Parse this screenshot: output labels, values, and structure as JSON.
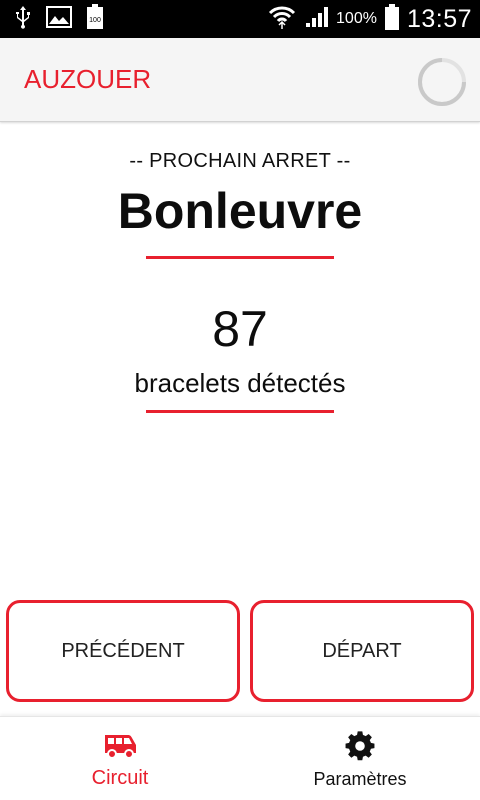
{
  "status_bar": {
    "battery_percent": "100%",
    "battery_small": "100",
    "time": "13:57",
    "icons": [
      "usb-icon",
      "image-icon",
      "battery-small-icon",
      "wifi-icon",
      "signal-icon",
      "battery-icon"
    ]
  },
  "app_bar": {
    "title": "AUZOUER",
    "spinner_icon": "loading-spinner-icon"
  },
  "main": {
    "next_stop_label": "-- PROCHAIN ARRET --",
    "stop_name": "Bonleuvre",
    "count": "87",
    "count_label": "bracelets détectés"
  },
  "actions": {
    "previous_label": "PRÉCÉDENT",
    "start_label": "DÉPART"
  },
  "bottom_nav": {
    "items": [
      {
        "label": "Circuit",
        "icon": "bus-icon",
        "active": true
      },
      {
        "label": "Paramètres",
        "icon": "gear-icon",
        "active": false
      }
    ]
  },
  "colors": {
    "accent": "#e8202e",
    "status_bar": "#000000",
    "app_bar": "#f5f5f5",
    "text": "#0d0d0d"
  }
}
